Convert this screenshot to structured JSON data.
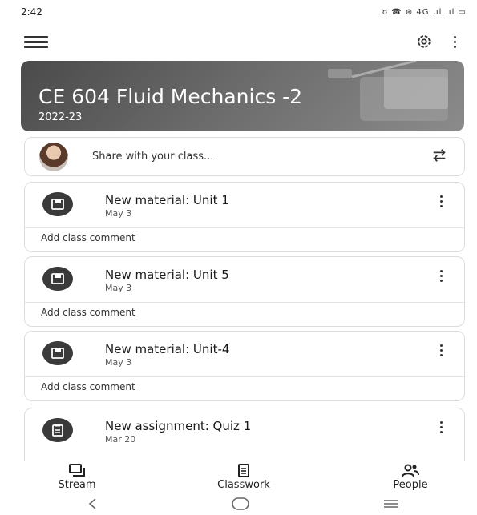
{
  "status_bar": {
    "time": "2:42",
    "indicators": "ʊ ☎ ⊛ 4G .ıl .ıl ▭"
  },
  "app_bar": {
    "menu_icon": "hamburger-icon",
    "settings_icon": "gear-icon",
    "more_icon": "more-vertical-icon"
  },
  "banner": {
    "title": "CE 604 Fluid Mechanics -2",
    "subtitle": "2022-23"
  },
  "share": {
    "placeholder": "Share with your class..."
  },
  "posts": [
    {
      "title": "New material: Unit 1",
      "date": "May 3",
      "comment": "Add class comment",
      "icon": "material-icon"
    },
    {
      "title": "New material: Unit 5",
      "date": "May 3",
      "comment": "Add class comment",
      "icon": "material-icon"
    },
    {
      "title": "New material: Unit-4",
      "date": "May 3",
      "comment": "Add class comment",
      "icon": "material-icon"
    },
    {
      "title": "New assignment: Quiz 1",
      "date": "Mar 20",
      "comment": "",
      "icon": "assignment-icon"
    }
  ],
  "bottom_nav": {
    "stream": "Stream",
    "classwork": "Classwork",
    "people": "People"
  }
}
